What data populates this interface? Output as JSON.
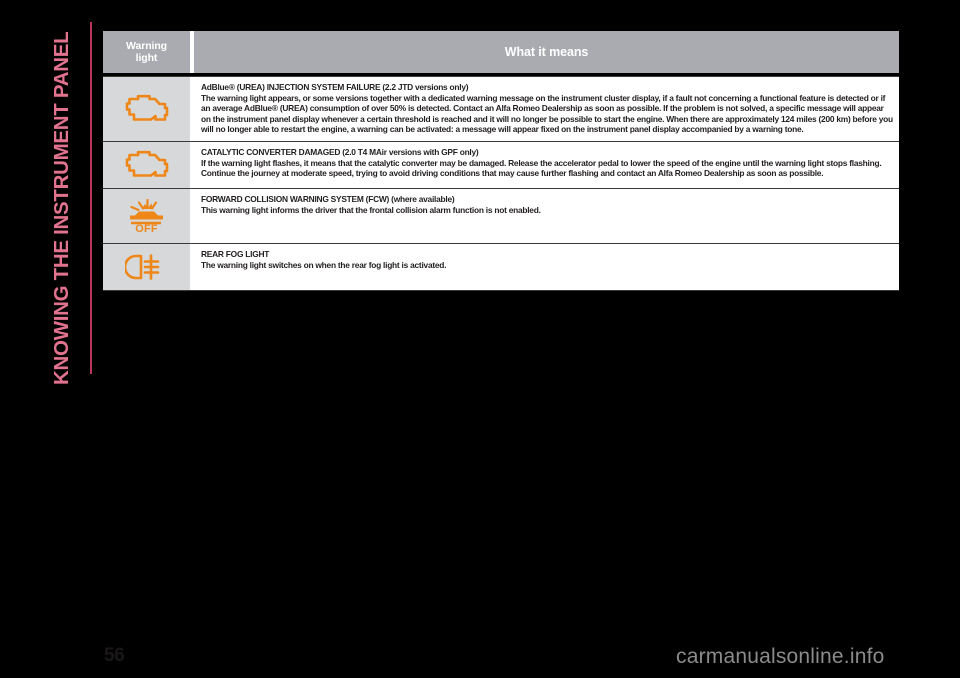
{
  "chapter": {
    "title": "KNOWING THE INSTRUMENT PANEL"
  },
  "page": {
    "number": "56",
    "watermark": "carmanualsonline.info"
  },
  "colors": {
    "background": "#000000",
    "chapter_text": "#e2738f",
    "chapter_rule": "#b8355c",
    "header_bg": "#a9abb0",
    "header_text": "#ffffff",
    "icon_cell_bg": "#d6d8da",
    "icon_orange": "#ee8618",
    "body_text": "#231f20",
    "watermark_text": "#8b8b8b"
  },
  "table": {
    "headers": {
      "warning_light_line1": "Warning",
      "warning_light_line2": "light",
      "what_it_means": "What it means"
    },
    "rows": [
      {
        "icon": "engine-check-icon",
        "title": "AdBlue® (UREA) INJECTION SYSTEM FAILURE (2.2 JTD versions only)",
        "body": "The warning light appears, or some versions together with a dedicated warning message on the instrument cluster display, if a fault not concerning a functional feature is detected or if an average AdBlue® (UREA) consumption of over 50% is detected. Contact an Alfa Romeo Dealership as soon as possible. If the problem is not solved, a specific message will appear on the instrument panel display whenever a certain threshold is reached and it will no longer be possible to start the engine. When there are approximately 124 miles (200 km) before you will no longer able to restart the engine, a warning can be activated: a message will appear fixed on the instrument panel display accompanied by a warning tone."
      },
      {
        "icon": "engine-check-icon",
        "title": "CATALYTIC CONVERTER DAMAGED (2.0 T4 MAir versions with GPF only)",
        "body": "If the warning light flashes, it means that the catalytic converter may be damaged. Release the accelerator pedal to lower the speed of the engine until the warning light stops flashing. Continue the journey at moderate speed, trying to avoid driving conditions that may cause further flashing and contact an Alfa Romeo Dealership as soon as possible."
      },
      {
        "icon": "forward-collision-off-icon",
        "title": "FORWARD COLLISION WARNING SYSTEM (FCW) (where available)",
        "body": "This warning light informs the driver that the frontal collision alarm function is not enabled."
      },
      {
        "icon": "rear-fog-light-icon",
        "title": "REAR FOG LIGHT",
        "body": "The warning light switches on when the rear fog light is activated."
      }
    ]
  }
}
